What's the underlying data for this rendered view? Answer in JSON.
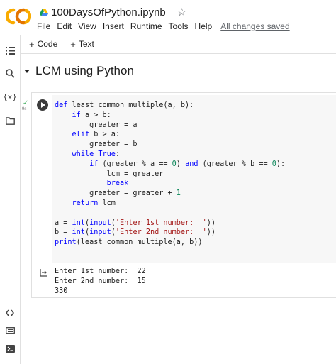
{
  "header": {
    "doc_title": "100DaysOfPython.ipynb",
    "menu": [
      "File",
      "Edit",
      "View",
      "Insert",
      "Runtime",
      "Tools",
      "Help"
    ],
    "save_status": "All changes saved"
  },
  "colors": {
    "logo_orange": "#f9ab00",
    "logo_dark": "#e37400",
    "keyword": "#0000ff",
    "number": "#098658",
    "string": "#a31515",
    "check": "#34a853"
  },
  "toolbar": {
    "add_code": "Code",
    "add_text": "Text"
  },
  "rail": {
    "icons": [
      "toc-icon",
      "search-icon",
      "variables-icon",
      "folder-icon",
      "code-snippets-icon",
      "command-palette-icon",
      "terminal-icon"
    ],
    "variables_label": "{x}"
  },
  "section": {
    "title": "LCM using Python"
  },
  "cell": {
    "exec_time": "9s",
    "code_lines": [
      "def least_common_multiple(a, b):",
      "    if a > b:",
      "        greater = a",
      "    elif b > a:",
      "        greater = b",
      "    while True:",
      "        if (greater % a == 0) and (greater % b == 0):",
      "            lcm = greater",
      "            break",
      "        greater = greater + 1",
      "    return lcm",
      "",
      "a = int(input('Enter 1st number:  '))",
      "b = int(input('Enter 2nd number:  '))",
      "print(least_common_multiple(a, b))"
    ],
    "output_lines": [
      "Enter 1st number:  22",
      "Enter 2nd number:  15",
      "330"
    ]
  }
}
